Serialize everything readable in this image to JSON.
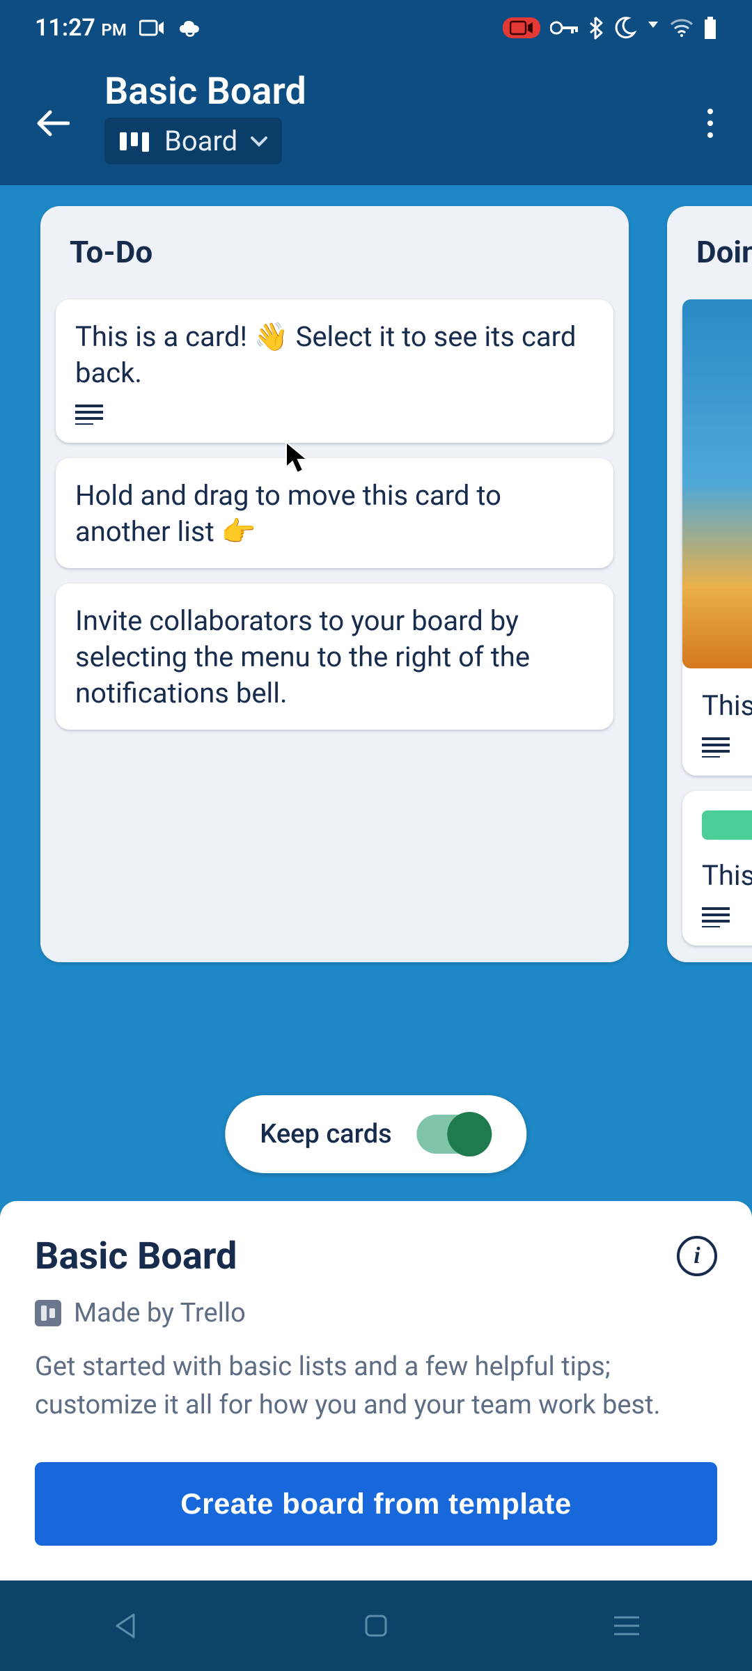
{
  "status": {
    "time": "11:27",
    "ampm": "PM"
  },
  "header": {
    "title": "Basic Board",
    "view_label": "Board"
  },
  "lists": [
    {
      "title": "To-Do",
      "cards": [
        {
          "text": "This is a card! 👋 Select it to see its card back.",
          "has_description": true
        },
        {
          "text": "Hold and drag to move this card to another list 👉",
          "has_description": false
        },
        {
          "text": "Invite collaborators to your board by selecting the menu to the right of the notifications bell.",
          "has_description": false
        }
      ]
    },
    {
      "title": "Doing",
      "cards": [
        {
          "text": "This",
          "has_description": true,
          "has_image": true
        },
        {
          "text": "This",
          "has_description": true,
          "has_green_label": true
        }
      ]
    }
  ],
  "keep_cards": {
    "label": "Keep cards",
    "enabled": true
  },
  "sheet": {
    "title": "Basic Board",
    "made_by": "Made by Trello",
    "description": "Get started with basic lists and a few helpful tips; customize it all for how you and your team work best.",
    "button": "Create board from template"
  }
}
